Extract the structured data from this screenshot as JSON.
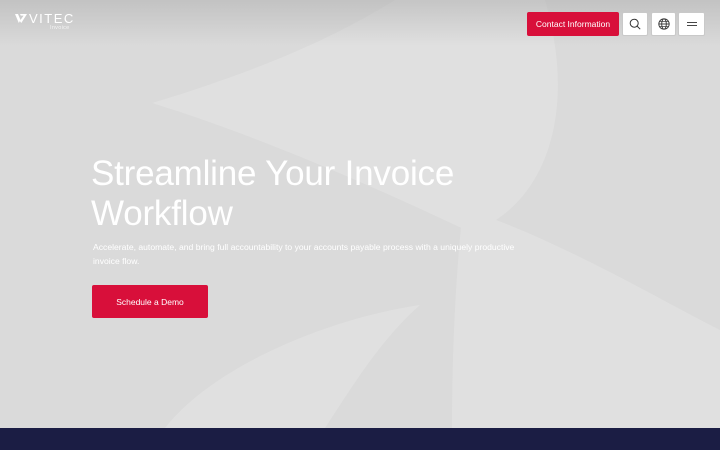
{
  "header": {
    "logo": {
      "wordmark": "VITEC",
      "subtitle": "Invoice"
    },
    "contact_label": "Contact Information",
    "icons": {
      "search": "search-icon",
      "language": "globe-icon",
      "menu": "hamburger-menu-icon"
    }
  },
  "hero": {
    "title": "Streamline Your Invoice Workflow",
    "description": "Accelerate, automate, and bring full accountability to your accounts payable process with a uniquely productive invoice flow.",
    "cta_label": "Schedule a Demo"
  },
  "colors": {
    "accent": "#d80f3a",
    "hero_background": "#dadada",
    "footer_background": "#1b1d44",
    "text_on_hero": "#ffffff"
  }
}
